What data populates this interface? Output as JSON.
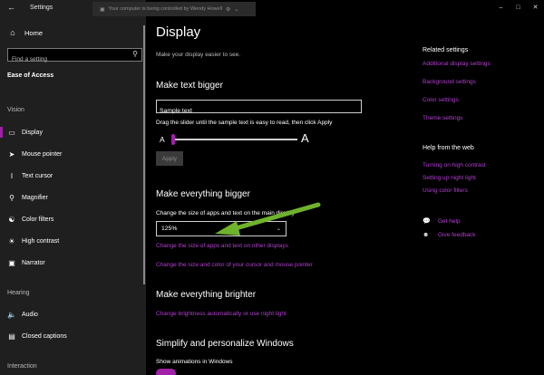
{
  "window": {
    "app_title": "Settings",
    "controlled_banner": "Your computer is being controlled by Wendy Howell"
  },
  "sidebar": {
    "home_label": "Home",
    "search_placeholder": "Find a setting",
    "section_title": "Ease of Access",
    "groups": [
      {
        "label": "Vision",
        "items": [
          {
            "label": "Display",
            "icon": "display-icon",
            "active": true
          },
          {
            "label": "Mouse pointer",
            "icon": "mouse-pointer-icon"
          },
          {
            "label": "Text cursor",
            "icon": "text-cursor-icon"
          },
          {
            "label": "Magnifier",
            "icon": "magnifier-icon"
          },
          {
            "label": "Color filters",
            "icon": "color-filters-icon"
          },
          {
            "label": "High contrast",
            "icon": "high-contrast-icon"
          },
          {
            "label": "Narrator",
            "icon": "narrator-icon"
          }
        ]
      },
      {
        "label": "Hearing",
        "items": [
          {
            "label": "Audio",
            "icon": "audio-icon"
          },
          {
            "label": "Closed captions",
            "icon": "closed-captions-icon"
          }
        ]
      },
      {
        "label": "Interaction",
        "items": []
      }
    ]
  },
  "main": {
    "title": "Display",
    "subtitle": "Make your display easier to see.",
    "text_bigger": {
      "heading": "Make text bigger",
      "sample_value": "Sample text",
      "instruction": "Drag the slider until the sample text is easy to read, then click Apply",
      "slider_min_label": "A",
      "slider_max_label": "A",
      "slider_level": 0.0,
      "apply_label": "Apply"
    },
    "everything_bigger": {
      "heading": "Make everything bigger",
      "description": "Change the size of apps and text on the main display",
      "selected_scale": "125%",
      "link_other_displays": "Change the size of apps and text on other displays",
      "link_cursor": "Change the size and color of your cursor and mouse pointer"
    },
    "everything_brighter": {
      "heading": "Make everything brighter",
      "link": "Change brightness automatically or use night light"
    },
    "simplify": {
      "heading": "Simplify and personalize Windows",
      "animations_label": "Show animations in Windows",
      "animations_on": true
    }
  },
  "right": {
    "related_heading": "Related settings",
    "related_links": [
      "Additional display settings",
      "Background settings",
      "Color settings",
      "Theme settings"
    ],
    "help_heading": "Help from the web",
    "help_links": [
      "Turning on high contrast",
      "Setting up night light",
      "Using color filters"
    ],
    "get_help": "Get help",
    "give_feedback": "Give feedback"
  },
  "colors": {
    "accent": "#a020a8",
    "link": "#b33fd1",
    "annotation_arrow": "#6fb22c"
  }
}
